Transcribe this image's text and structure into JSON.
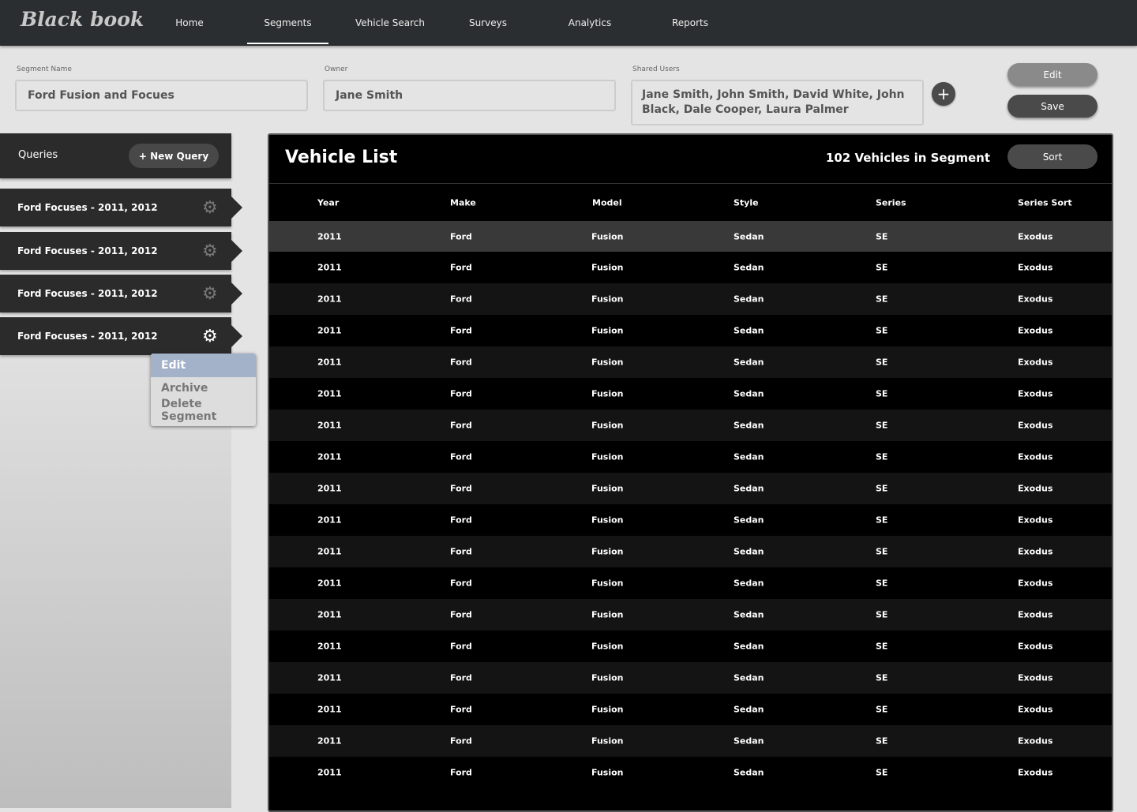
{
  "app": {
    "logo": "Black book"
  },
  "nav": [
    "Home",
    "Segments",
    "Vehicle Search",
    "Surveys",
    "Analytics",
    "Reports"
  ],
  "nav_active": "Segments",
  "form": {
    "segment_name_label": "Segment Name",
    "segment_name": "Ford Fusion and Focues",
    "owner_label": "Owner",
    "owner": "Jane Smith",
    "shared_label": "Shared Users",
    "shared_users": "Jane Smith, John Smith, David White, John Black, Dale Cooper, Laura Palmer",
    "add": "+"
  },
  "actions": {
    "edit": "Edit",
    "save": "Save"
  },
  "queries": {
    "title": "Queries",
    "new_query": "+   New Query",
    "items": [
      "Ford Focuses - 2011, 2012",
      "Ford Focuses - 2011, 2012",
      "Ford Focuses - 2011, 2012",
      "Ford Focuses - 2011, 2012"
    ]
  },
  "context_menu": [
    "Edit",
    "Archive",
    "Delete Segment"
  ],
  "vehicles": {
    "title": "Vehicle List",
    "count": "102 Vehicles in Segment",
    "sort": "Sort",
    "columns": [
      "Year",
      "Make",
      "Model",
      "Style",
      "Series",
      "Series Sort"
    ],
    "rows": [
      [
        "2011",
        "Ford",
        "Fusion",
        "Sedan",
        "SE",
        "Exodus"
      ],
      [
        "2011",
        "Ford",
        "Fusion",
        "Sedan",
        "SE",
        "Exodus"
      ],
      [
        "2011",
        "Ford",
        "Fusion",
        "Sedan",
        "SE",
        "Exodus"
      ],
      [
        "2011",
        "Ford",
        "Fusion",
        "Sedan",
        "SE",
        "Exodus"
      ],
      [
        "2011",
        "Ford",
        "Fusion",
        "Sedan",
        "SE",
        "Exodus"
      ],
      [
        "2011",
        "Ford",
        "Fusion",
        "Sedan",
        "SE",
        "Exodus"
      ],
      [
        "2011",
        "Ford",
        "Fusion",
        "Sedan",
        "SE",
        "Exodus"
      ],
      [
        "2011",
        "Ford",
        "Fusion",
        "Sedan",
        "SE",
        "Exodus"
      ],
      [
        "2011",
        "Ford",
        "Fusion",
        "Sedan",
        "SE",
        "Exodus"
      ],
      [
        "2011",
        "Ford",
        "Fusion",
        "Sedan",
        "SE",
        "Exodus"
      ],
      [
        "2011",
        "Ford",
        "Fusion",
        "Sedan",
        "SE",
        "Exodus"
      ],
      [
        "2011",
        "Ford",
        "Fusion",
        "Sedan",
        "SE",
        "Exodus"
      ],
      [
        "2011",
        "Ford",
        "Fusion",
        "Sedan",
        "SE",
        "Exodus"
      ],
      [
        "2011",
        "Ford",
        "Fusion",
        "Sedan",
        "SE",
        "Exodus"
      ],
      [
        "2011",
        "Ford",
        "Fusion",
        "Sedan",
        "SE",
        "Exodus"
      ],
      [
        "2011",
        "Ford",
        "Fusion",
        "Sedan",
        "SE",
        "Exodus"
      ],
      [
        "2011",
        "Ford",
        "Fusion",
        "Sedan",
        "SE",
        "Exodus"
      ],
      [
        "2011",
        "Ford",
        "Fusion",
        "Sedan",
        "SE",
        "Exodus"
      ]
    ]
  }
}
